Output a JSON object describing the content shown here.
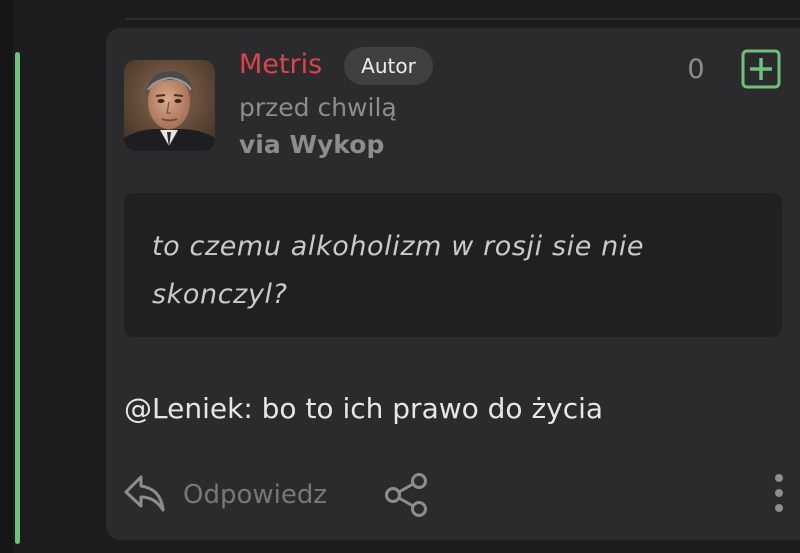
{
  "comment": {
    "author": "Metris",
    "badge": "Autor",
    "time": "przed chwilą",
    "via": "via Wykop",
    "votes": "0",
    "quote": "to czemu alkoholizm w rosji sie nie skonczyl?",
    "mention": "@Leniek",
    "body": ": bo to ich prawo do życia"
  },
  "actions": {
    "reply_label": "Odpowiedz"
  },
  "colors": {
    "accent_green": "#6ec07a",
    "author_red": "#d8454b",
    "card_bg": "#2b2b2d",
    "quote_bg": "#202022"
  },
  "icons": {
    "plus": "plus-square-icon",
    "reply": "reply-arrow-icon",
    "share": "share-icon",
    "more": "more-vertical-icon"
  }
}
